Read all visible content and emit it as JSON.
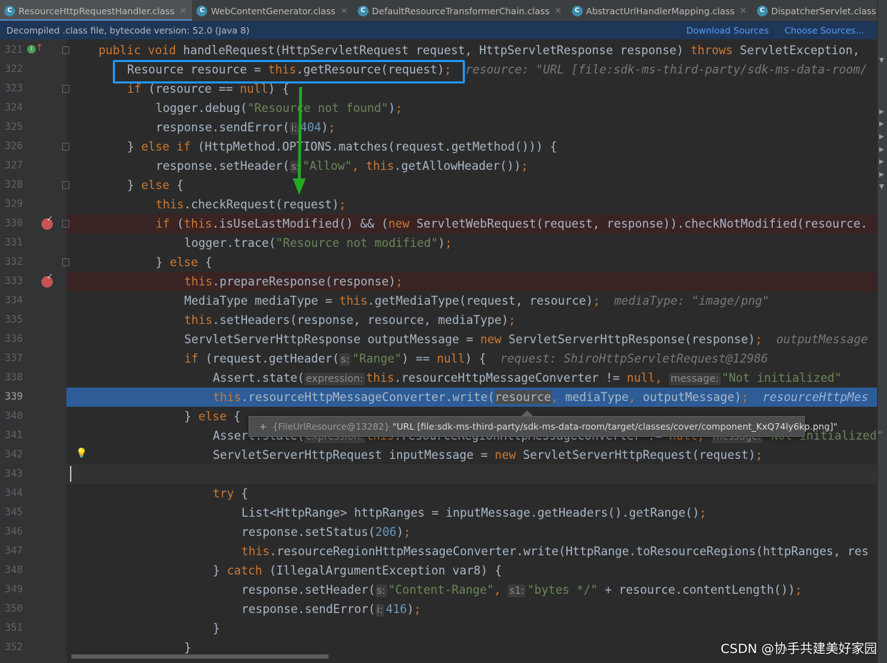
{
  "tabs": [
    {
      "label": "ResourceHttpRequestHandler.class",
      "active": true
    },
    {
      "label": "WebContentGenerator.class"
    },
    {
      "label": "DefaultResourceTransformerChain.class"
    },
    {
      "label": "AbstractUrlHandlerMapping.class"
    },
    {
      "label": "DispatcherServlet.class"
    }
  ],
  "tab_overflow": "▾≡5",
  "notification": {
    "text": "Decompiled .class file, bytecode version: 52.0 (Java 8)",
    "download_sources": "Download Sources",
    "choose_sources": "Choose Sources..."
  },
  "colors": {
    "keyword": "#cc7832",
    "string": "#6a8759",
    "number": "#6897bb",
    "text": "#a9b7c6",
    "exec_line": "#2d5c97",
    "breakpoint_line": "#3a2323",
    "highlight_box": "#2196f3",
    "arrow": "#22aa22"
  },
  "code_lines": [
    {
      "n": "321",
      "i": 1,
      "gut": "implements",
      "t": [
        [
          "kw",
          "public void"
        ],
        [
          "p",
          " handleRequest(HttpServletRequest request, HttpServletResponse response) "
        ],
        [
          "kw",
          "throws"
        ],
        [
          "p",
          " ServletException, "
        ]
      ]
    },
    {
      "n": "322",
      "i": 2,
      "t": [
        [
          "p",
          "Resource resource = "
        ],
        [
          "kw",
          "this"
        ],
        [
          "p",
          ".getResource(request)"
        ],
        [
          "kw",
          ";"
        ],
        [
          "inl",
          "  resource: \"URL [file:sdk-ms-third-party/sdk-ms-data-room/"
        ]
      ]
    },
    {
      "n": "323",
      "i": 2,
      "t": [
        [
          "kw",
          "if"
        ],
        [
          "p",
          " (resource == "
        ],
        [
          "kw",
          "null"
        ],
        [
          "p",
          ") {"
        ]
      ]
    },
    {
      "n": "324",
      "i": 3,
      "t": [
        [
          "p",
          "logger.debug("
        ],
        [
          "str",
          "\"Resource not found\""
        ],
        [
          "p",
          ")"
        ],
        [
          "kw",
          ";"
        ]
      ]
    },
    {
      "n": "325",
      "i": 3,
      "t": [
        [
          "p",
          "response.sendError("
        ],
        [
          "hint",
          "i:"
        ],
        [
          "num",
          "404"
        ],
        [
          "p",
          ")"
        ],
        [
          "kw",
          ";"
        ]
      ]
    },
    {
      "n": "326",
      "i": 2,
      "t": [
        [
          "p",
          "} "
        ],
        [
          "kw",
          "else if"
        ],
        [
          "p",
          " (HttpMethod.OPTIONS.matches(request.getMethod())) {"
        ]
      ]
    },
    {
      "n": "327",
      "i": 3,
      "t": [
        [
          "p",
          "response.setHeader("
        ],
        [
          "hint",
          "s:"
        ],
        [
          "str",
          "\"Allow\""
        ],
        [
          "kw",
          ", "
        ],
        [
          "kw",
          "this"
        ],
        [
          "p",
          ".getAllowHeader())"
        ],
        [
          "kw",
          ";"
        ]
      ]
    },
    {
      "n": "328",
      "i": 2,
      "t": [
        [
          "p",
          "} "
        ],
        [
          "kw",
          "else"
        ],
        [
          "p",
          " {"
        ]
      ]
    },
    {
      "n": "329",
      "i": 3,
      "t": [
        [
          "kw",
          "this"
        ],
        [
          "p",
          ".checkRequest(request)"
        ],
        [
          "kw",
          ";"
        ]
      ]
    },
    {
      "n": "330",
      "i": 3,
      "bp": true,
      "t": [
        [
          "kw",
          "if"
        ],
        [
          "p",
          " ("
        ],
        [
          "kw",
          "this"
        ],
        [
          "p",
          ".isUseLastModified() && ("
        ],
        [
          "kw",
          "new"
        ],
        [
          "p",
          " ServletWebRequest(request, response)).checkNotModified(resource."
        ]
      ]
    },
    {
      "n": "331",
      "i": 4,
      "t": [
        [
          "p",
          "logger.trace("
        ],
        [
          "str",
          "\"Resource not modified\""
        ],
        [
          "p",
          ")"
        ],
        [
          "kw",
          ";"
        ]
      ]
    },
    {
      "n": "332",
      "i": 3,
      "t": [
        [
          "p",
          "} "
        ],
        [
          "kw",
          "else"
        ],
        [
          "p",
          " {"
        ]
      ]
    },
    {
      "n": "333",
      "i": 4,
      "bp": true,
      "t": [
        [
          "kw",
          "this"
        ],
        [
          "p",
          ".prepareResponse(response)"
        ],
        [
          "kw",
          ";"
        ]
      ]
    },
    {
      "n": "334",
      "i": 4,
      "t": [
        [
          "p",
          "MediaType mediaType = "
        ],
        [
          "kw",
          "this"
        ],
        [
          "p",
          ".getMediaType(request, resource)"
        ],
        [
          "kw",
          ";"
        ],
        [
          "inl",
          "  mediaType: \"image/png\""
        ]
      ]
    },
    {
      "n": "335",
      "i": 4,
      "t": [
        [
          "kw",
          "this"
        ],
        [
          "p",
          ".setHeaders(response, resource, mediaType)"
        ],
        [
          "kw",
          ";"
        ]
      ]
    },
    {
      "n": "336",
      "i": 4,
      "t": [
        [
          "p",
          "ServletServerHttpResponse outputMessage = "
        ],
        [
          "kw",
          "new"
        ],
        [
          "p",
          " ServletServerHttpResponse(response)"
        ],
        [
          "kw",
          ";"
        ],
        [
          "inl",
          "  outputMessage"
        ]
      ]
    },
    {
      "n": "337",
      "i": 4,
      "t": [
        [
          "kw",
          "if"
        ],
        [
          "p",
          " (request.getHeader("
        ],
        [
          "hint",
          "s:"
        ],
        [
          "str",
          "\"Range\""
        ],
        [
          "p",
          ") == "
        ],
        [
          "kw",
          "null"
        ],
        [
          "p",
          ") {"
        ],
        [
          "inl",
          "  request: ShiroHttpServletRequest@12986"
        ]
      ]
    },
    {
      "n": "338",
      "i": 5,
      "t": [
        [
          "p",
          "Assert.state("
        ],
        [
          "hint",
          "expression:"
        ],
        [
          "kw",
          "this"
        ],
        [
          "p",
          ".resourceHttpMessageConverter != "
        ],
        [
          "kw",
          "null"
        ],
        [
          "kw",
          ", "
        ],
        [
          "hint",
          "message:"
        ],
        [
          "str",
          "\"Not initialized\""
        ]
      ]
    },
    {
      "n": "339",
      "i": 5,
      "exec": true,
      "t": [
        [
          "kw",
          "this"
        ],
        [
          "p",
          ".resourceHttpMessageConverter.write("
        ],
        [
          "hl",
          "resource"
        ],
        [
          "kw",
          ", "
        ],
        [
          "p",
          "mediaType"
        ],
        [
          "kw",
          ", "
        ],
        [
          "p",
          "outputMessage)"
        ],
        [
          "kw",
          ";"
        ],
        [
          "inl",
          "  resourceHttpMes"
        ]
      ]
    },
    {
      "n": "340",
      "i": 4,
      "t": [
        [
          "p",
          "} "
        ],
        [
          "kw",
          "else"
        ],
        [
          "p",
          " {"
        ]
      ]
    },
    {
      "n": "341",
      "i": 5,
      "t": [
        [
          "p",
          "Assert.state("
        ],
        [
          "hint",
          "expression:"
        ],
        [
          "kw",
          "this"
        ],
        [
          "p",
          ".resourceRegionHttpMessageConverter != "
        ],
        [
          "kw",
          "null"
        ],
        [
          "kw",
          ", "
        ],
        [
          "hint",
          "message:"
        ],
        [
          "str",
          "\"Not initialized\""
        ]
      ]
    },
    {
      "n": "342",
      "i": 5,
      "gut": "bulb",
      "t": [
        [
          "p",
          "ServletServerHttpRequest inputMessage = "
        ],
        [
          "kw",
          "new"
        ],
        [
          "p",
          " ServletServerHttpRequest(request)"
        ],
        [
          "kw",
          ";"
        ]
      ]
    },
    {
      "n": "343",
      "i": 0,
      "caret": true,
      "t": []
    },
    {
      "n": "344",
      "i": 5,
      "t": [
        [
          "kw",
          "try"
        ],
        [
          "p",
          " {"
        ]
      ]
    },
    {
      "n": "345",
      "i": 6,
      "t": [
        [
          "p",
          "List<HttpRange> httpRanges = inputMessage.getHeaders().getRange()"
        ],
        [
          "kw",
          ";"
        ]
      ]
    },
    {
      "n": "346",
      "i": 6,
      "t": [
        [
          "p",
          "response.setStatus("
        ],
        [
          "num",
          "206"
        ],
        [
          "p",
          ")"
        ],
        [
          "kw",
          ";"
        ]
      ]
    },
    {
      "n": "347",
      "i": 6,
      "t": [
        [
          "kw",
          "this"
        ],
        [
          "p",
          ".resourceRegionHttpMessageConverter.write(HttpRange.toResourceRegions(httpRanges, res"
        ]
      ]
    },
    {
      "n": "348",
      "i": 5,
      "t": [
        [
          "p",
          "} "
        ],
        [
          "kw",
          "catch"
        ],
        [
          "p",
          " (IllegalArgumentException var8) {"
        ]
      ]
    },
    {
      "n": "349",
      "i": 6,
      "t": [
        [
          "p",
          "response.setHeader("
        ],
        [
          "hint",
          "s:"
        ],
        [
          "str",
          "\"Content-Range\""
        ],
        [
          "kw",
          ", "
        ],
        [
          "hint",
          "s1:"
        ],
        [
          "str",
          "\"bytes */\""
        ],
        [
          "p",
          " + resource.contentLength())"
        ],
        [
          "kw",
          ";"
        ]
      ]
    },
    {
      "n": "350",
      "i": 6,
      "t": [
        [
          "p",
          "response.sendError("
        ],
        [
          "hint",
          "i:"
        ],
        [
          "num",
          "416"
        ],
        [
          "p",
          ")"
        ],
        [
          "kw",
          ";"
        ]
      ]
    },
    {
      "n": "351",
      "i": 5,
      "t": [
        [
          "p",
          "}"
        ]
      ]
    },
    {
      "n": "352",
      "i": 4,
      "t": [
        [
          "p",
          "}"
        ]
      ]
    }
  ],
  "tooltip": {
    "type": "{FileUrlResource@13282}",
    "value": "\"URL [file:sdk-ms-third-party/sdk-ms-data-room/target/classes/cover/component_KxQ74ly6kp.png]\""
  },
  "watermark": "CSDN @协手共建美好家园"
}
